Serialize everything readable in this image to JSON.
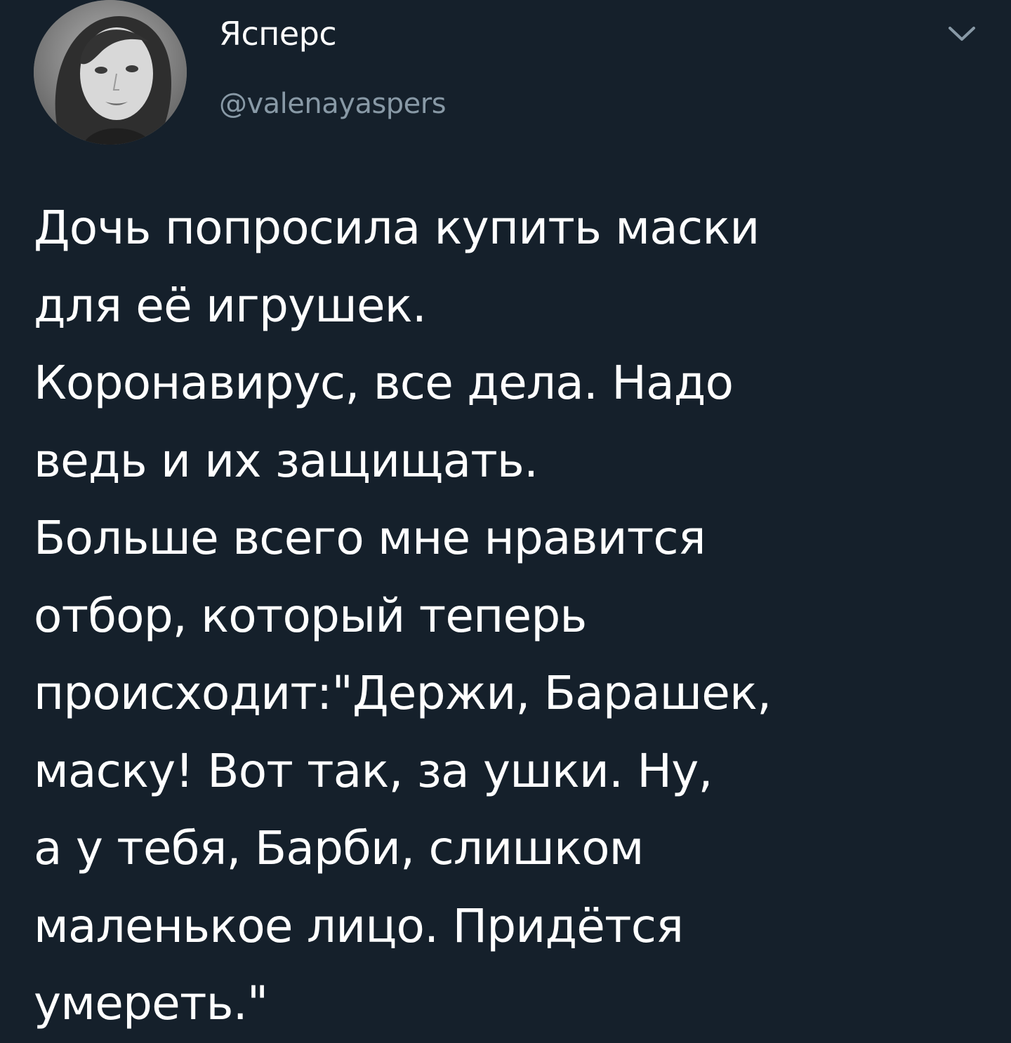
{
  "user": {
    "display_name": "Ясперс",
    "handle": "@valenayaspers"
  },
  "tweet": {
    "lines": [
      "Дочь попросила купить маски",
      "для её игрушек.",
      "Коронавирус, все дела. Надо",
      "ведь и их защищать.",
      "Больше всего мне нравится",
      "отбор, который теперь",
      "происходит:\"Держи, Барашек,",
      "маску! Вот так, за ушки. Ну,",
      "а у тебя, Барби, слишком",
      "маленькое лицо. Придётся",
      "умереть.\""
    ]
  },
  "colors": {
    "background": "#15202b",
    "text": "#ffffff",
    "secondary_text": "#8899a6"
  },
  "icons": {
    "caret": "chevron-down-icon"
  }
}
